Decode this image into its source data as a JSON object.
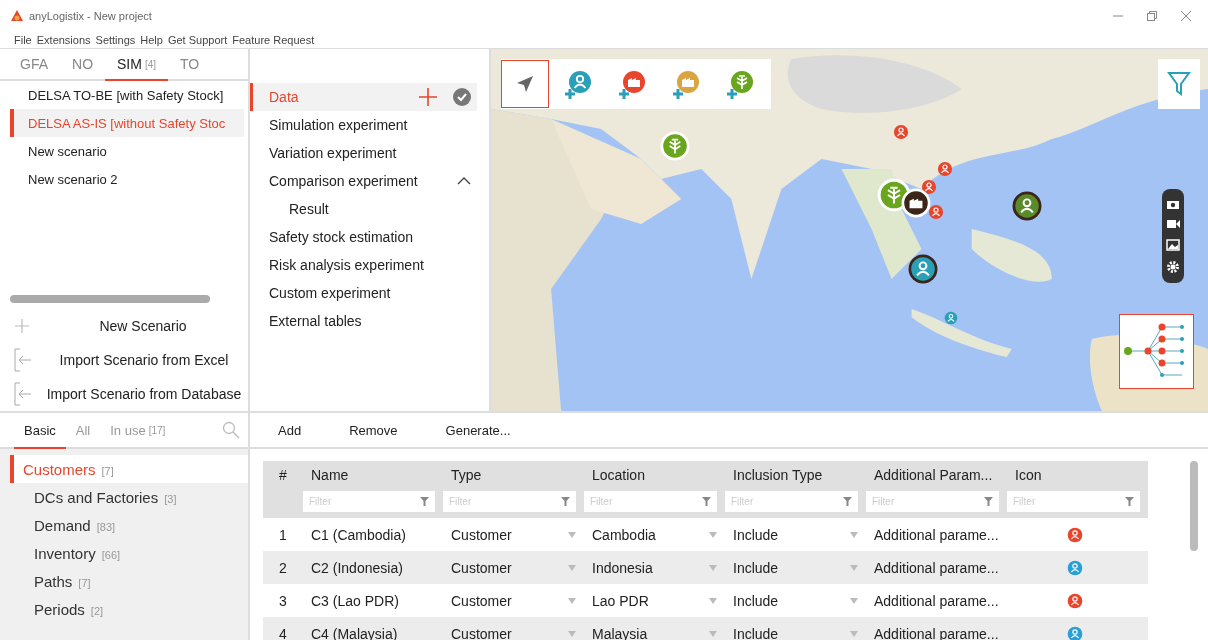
{
  "window": {
    "title": "anyLogistix - New project"
  },
  "menu": [
    "File",
    "Extensions",
    "Settings",
    "Help",
    "Get Support",
    "Feature Request"
  ],
  "scenario_tabs": [
    {
      "label": "GFA",
      "selected": false
    },
    {
      "label": "NO",
      "selected": false
    },
    {
      "label": "SIM",
      "count": "[4]",
      "selected": true
    },
    {
      "label": "TO",
      "selected": false
    }
  ],
  "scenarios": [
    {
      "label": "DELSA TO-BE [with Safety Stock]",
      "selected": false
    },
    {
      "label": "DELSA AS-IS [without Safety Stoc",
      "selected": true
    },
    {
      "label": "New scenario",
      "selected": false
    },
    {
      "label": "New scenario 2",
      "selected": false
    }
  ],
  "scenario_actions": [
    {
      "kind": "add",
      "label": "New Scenario"
    },
    {
      "kind": "import",
      "label": "Import Scenario from Excel"
    },
    {
      "kind": "import",
      "label": "Import Scenario from Database"
    }
  ],
  "experiments": [
    {
      "kind": "data",
      "label": "Data",
      "selected": true
    },
    {
      "kind": "experiment",
      "label": "Simulation experiment",
      "selected": false
    },
    {
      "kind": "experiment",
      "label": "Variation experiment",
      "selected": false
    },
    {
      "kind": "experiment",
      "label": "Comparison experiment",
      "selected": false,
      "expanded": true,
      "children": [
        {
          "label": "Result",
          "selected": false
        }
      ]
    },
    {
      "kind": "experiment",
      "label": "Safety stock estimation",
      "selected": false
    },
    {
      "kind": "experiment",
      "label": "Risk analysis experiment",
      "selected": false
    },
    {
      "kind": "experiment",
      "label": "Custom experiment",
      "selected": false
    },
    {
      "kind": "experiment",
      "label": "External tables",
      "selected": false
    }
  ],
  "map": {
    "kind": "picture",
    "tools": [
      {
        "kind": "select",
        "selected": true
      },
      {
        "kind": "customer",
        "selected": false
      },
      {
        "kind": "factory",
        "selected": false
      },
      {
        "kind": "warehouse",
        "selected": false
      },
      {
        "kind": "supplier",
        "selected": false
      }
    ]
  },
  "data_tabs": [
    {
      "label": "Basic",
      "selected": true
    },
    {
      "label": "All",
      "selected": false
    },
    {
      "label": "In use",
      "count": "[17]",
      "selected": false
    }
  ],
  "tables": [
    {
      "label": "Customers",
      "count": "[7]",
      "selected": true
    },
    {
      "label": "DCs and Factories",
      "count": "[3]",
      "selected": false
    },
    {
      "label": "Demand",
      "count": "[83]",
      "selected": false
    },
    {
      "label": "Inventory",
      "count": "[66]",
      "selected": false
    },
    {
      "label": "Paths",
      "count": "[7]",
      "selected": false
    },
    {
      "label": "Periods",
      "count": "[2]",
      "selected": false
    }
  ],
  "toolbar": [
    "Add",
    "Remove",
    "Generate..."
  ],
  "table": {
    "columns": [
      {
        "label": "#",
        "kind": "text"
      },
      {
        "label": "Name",
        "filter": "Filter",
        "kind": "text"
      },
      {
        "label": "Type",
        "filter": "Filter",
        "kind": "choice"
      },
      {
        "label": "Location",
        "filter": "Filter",
        "kind": "choice"
      },
      {
        "label": "Inclusion Type",
        "filter": "Filter",
        "kind": "choice"
      },
      {
        "label": "Additional Param...",
        "filter": "Filter",
        "kind": "text"
      },
      {
        "label": "Icon",
        "filter": "Filter",
        "kind": "icon"
      }
    ],
    "rows": [
      {
        "cells": [
          "1",
          "C1 (Cambodia)",
          "Customer",
          "Cambodia",
          "Include",
          "Additional parame..."
        ],
        "color": "#e8452c"
      },
      {
        "cells": [
          "2",
          "C2 (Indonesia)",
          "Customer",
          "Indonesia",
          "Include",
          "Additional parame..."
        ],
        "color": "#2a9fd6"
      },
      {
        "cells": [
          "3",
          "C3 (Lao PDR)",
          "Customer",
          "Lao PDR",
          "Include",
          "Additional parame..."
        ],
        "color": "#e8452c"
      },
      {
        "cells": [
          "4",
          "C4 (Malaysia)",
          "Customer",
          "Malaysia",
          "Include",
          "Additional parame..."
        ],
        "color": "#2a9fd6"
      }
    ]
  }
}
